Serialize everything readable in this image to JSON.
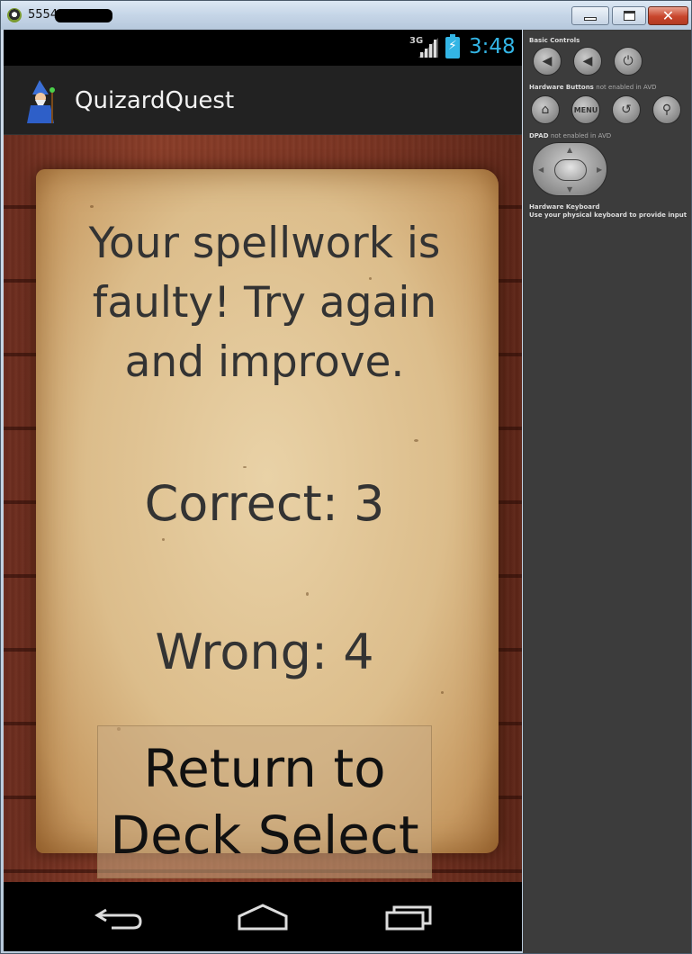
{
  "window": {
    "title": "5554",
    "minimize_label": "—",
    "maximize_label": "☐",
    "close_label": "✕"
  },
  "statusbar": {
    "network": "3G",
    "time": "3:48"
  },
  "actionbar": {
    "app_title": "QuizardQuest",
    "app_icon": "wizard-icon"
  },
  "result": {
    "message": "Your spellwork is faulty! Try again and improve.",
    "correct": "Correct: 3",
    "wrong": "Wrong: 4",
    "return_button": "Return to Deck Select"
  },
  "navbar": {
    "back_icon": "back-icon",
    "home_icon": "home-icon",
    "recent_icon": "recent-apps-icon"
  },
  "controls": {
    "basic_controls_label": "Basic Controls",
    "hardware_buttons_label": "Hardware Buttons",
    "hardware_buttons_note": "not enabled in AVD",
    "menu_label": "MENU",
    "dpad_label": "DPAD",
    "dpad_note": "not enabled in AVD",
    "keyboard_label": "Hardware Keyboard",
    "keyboard_note": "Use your physical keyboard to provide input"
  },
  "colors": {
    "accent": "#33b5e5",
    "actionbar": "#222222",
    "panel": "#3c3c3c"
  }
}
